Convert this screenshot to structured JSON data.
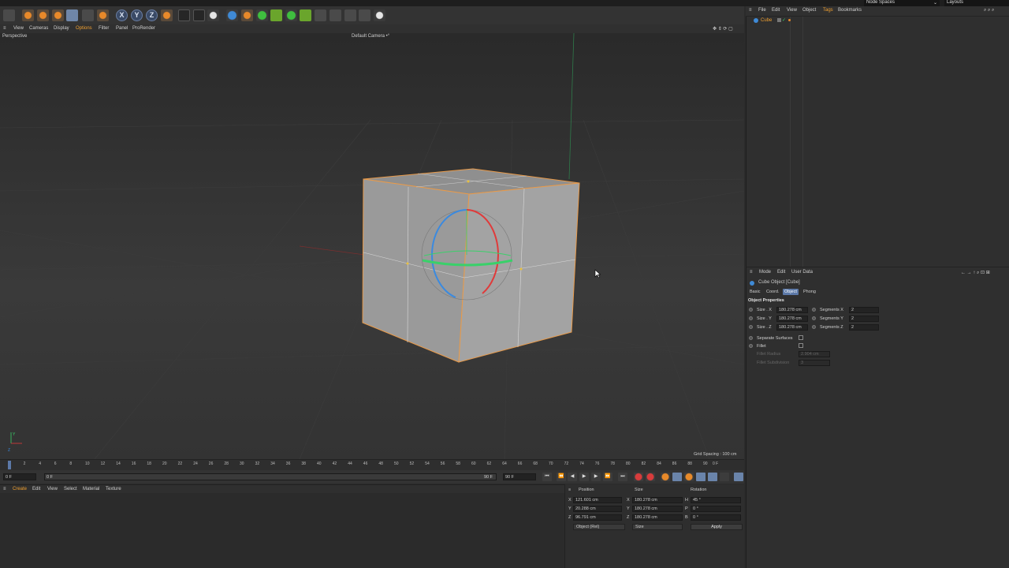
{
  "top": {
    "node_spaces": "Node Spaces",
    "layouts": "Layouts"
  },
  "viewport_menu": [
    "View",
    "Cameras",
    "Display",
    "Options",
    "Filter",
    "Panel",
    "ProRender"
  ],
  "viewport": {
    "label": "Perspective",
    "camera": "Default Camera •°",
    "grid_spacing": "Grid Spacing : 100 cm"
  },
  "timeline": {
    "ticks": [
      "0",
      "2",
      "4",
      "6",
      "8",
      "10",
      "12",
      "14",
      "16",
      "18",
      "20",
      "22",
      "24",
      "26",
      "28",
      "30",
      "32",
      "34",
      "36",
      "38",
      "40",
      "42",
      "44",
      "46",
      "48",
      "50",
      "52",
      "54",
      "56",
      "58",
      "60",
      "62",
      "64",
      "66",
      "68",
      "70",
      "72",
      "74",
      "76",
      "78",
      "80",
      "82",
      "84",
      "86",
      "88",
      "90"
    ],
    "end_marker": "0 F",
    "start_field": "0 F",
    "current_field": "0 F",
    "end_field": "90 F",
    "max_field": "90 F"
  },
  "material_menu": {
    "create": "Create",
    "edit": "Edit",
    "view": "View",
    "select": "Select",
    "material": "Material",
    "texture": "Texture"
  },
  "coords": {
    "headers": {
      "position": "Position",
      "size": "Size",
      "rotation": "Rotation"
    },
    "rows": [
      {
        "axis": "X",
        "position": "121.601 cm",
        "size_axis": "X",
        "size": "180.278 cm",
        "rot_axis": "H",
        "rotation": "45 °"
      },
      {
        "axis": "Y",
        "position": "20.288 cm",
        "size_axis": "Y",
        "size": "180.278 cm",
        "rot_axis": "P",
        "rotation": "0 °"
      },
      {
        "axis": "Z",
        "position": "96.791 cm",
        "size_axis": "Z",
        "size": "180.278 cm",
        "rot_axis": "B",
        "rotation": "0 °"
      }
    ],
    "mode_select": "Object (Rel)",
    "size_select": "Size",
    "apply": "Apply"
  },
  "object_manager": {
    "menu": [
      "File",
      "Edit",
      "View",
      "Object",
      "Tags",
      "Bookmarks"
    ],
    "object_name": "Cube"
  },
  "attributes": {
    "menu": [
      "Mode",
      "Edit",
      "User Data"
    ],
    "title": "Cube Object [Cube]",
    "tabs": [
      "Basic",
      "Coord.",
      "Object",
      "Phong"
    ],
    "section": "Object Properties",
    "size_x_label": "Size . X",
    "size_x": "180.278 cm",
    "size_y_label": "Size . Y",
    "size_y": "180.278 cm",
    "size_z_label": "Size . Z",
    "size_z": "180.278 cm",
    "seg_x_label": "Segments X",
    "seg_x": "2",
    "seg_y_label": "Segments Y",
    "seg_y": "2",
    "seg_z_label": "Segments Z",
    "seg_z": "2",
    "separate_surfaces": "Separate Surfaces",
    "fillet": "Fillet",
    "fillet_radius_label": "Fillet Radius",
    "fillet_radius": "2.904 cm",
    "fillet_subdivision_label": "Fillet Subdivision",
    "fillet_subdivision": "3"
  },
  "colors": {
    "accent": "#e8892a",
    "active_tab": "#5c79a8",
    "selection_outline": "#e89a4a",
    "x_axis": "#e03a3a",
    "y_axis": "#3ad06a",
    "z_axis": "#3a8ae0"
  }
}
